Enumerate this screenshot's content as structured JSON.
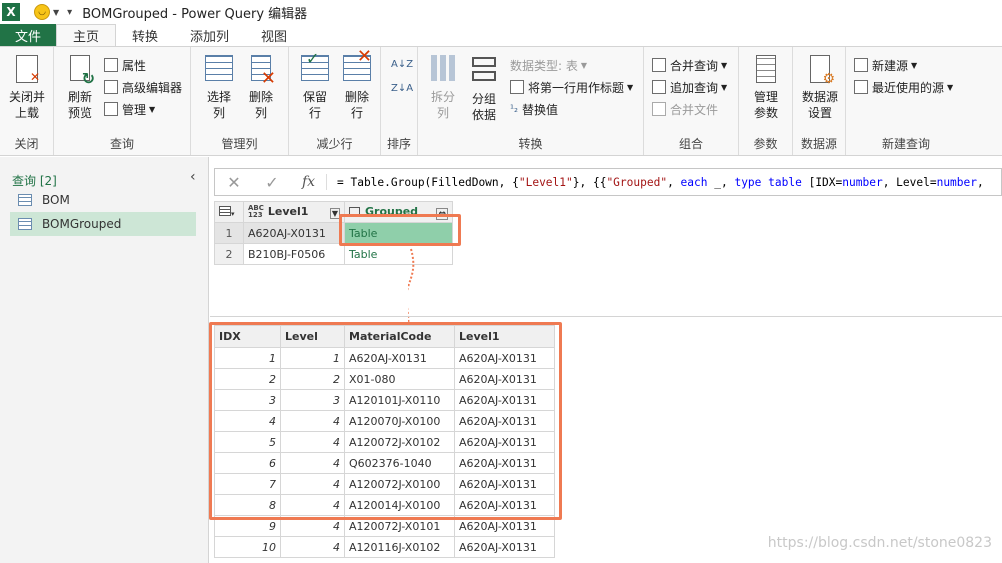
{
  "window": {
    "app_icon": "X",
    "title": "BOMGrouped - Power Query 编辑器"
  },
  "tabs": [
    "文件",
    "主页",
    "转换",
    "添加列",
    "视图"
  ],
  "ribbon": {
    "close": {
      "btn": "关闭并\n上载",
      "label": "关闭"
    },
    "query": {
      "refresh": "刷新\n预览",
      "properties": "属性",
      "advanced_editor": "高级编辑器",
      "manage": "管理",
      "label": "查询"
    },
    "manage_columns": {
      "choose": "选择\n列",
      "remove": "删除\n列",
      "label": "管理列"
    },
    "reduce_rows": {
      "keep": "保留\n行",
      "remove": "删除\n行",
      "label": "减少行"
    },
    "sort": {
      "label": "排序"
    },
    "transform": {
      "split": "拆分\n列",
      "group": "分组\n依据",
      "data_type": "数据类型: 表",
      "first_row_header": "将第一行用作标题",
      "replace": "替换值",
      "label": "转换"
    },
    "combine": {
      "merge": "合并查询",
      "append": "追加查询",
      "combine_files": "合并文件",
      "label": "组合"
    },
    "params": {
      "manage": "管理\n参数",
      "label": "参数"
    },
    "datasource": {
      "settings": "数据源\n设置",
      "label": "数据源"
    },
    "new_query": {
      "new_source": "新建源",
      "recent": "最近使用的源",
      "label": "新建查询"
    }
  },
  "queries_panel": {
    "header": "查询 [2]",
    "items": [
      "BOM",
      "BOMGrouped"
    ]
  },
  "formula": {
    "cancel": "✕",
    "confirm": "✓",
    "fx": "fx",
    "text_parts": [
      "= Table.Group(FilledDown, {",
      "\"Level1\"",
      "}, {{",
      "\"Grouped\"",
      ", ",
      "each",
      " _, ",
      "type",
      " ",
      "table",
      " [IDX=",
      "number",
      ", Level=",
      "number",
      ","
    ]
  },
  "grouped_grid": {
    "col1_type": "ABC\n123",
    "col1": "Level1",
    "col2": "Grouped",
    "rows": [
      {
        "n": "1",
        "level1": "A620AJ-X0131",
        "grouped": "Table"
      },
      {
        "n": "2",
        "level1": "B210BJ-F0506",
        "grouped": "Table"
      }
    ]
  },
  "detail_table": {
    "headers": [
      "IDX",
      "Level",
      "MaterialCode",
      "Level1"
    ],
    "rows": [
      [
        "1",
        "1",
        "A620AJ-X0131",
        "A620AJ-X0131"
      ],
      [
        "2",
        "2",
        "X01-080",
        "A620AJ-X0131"
      ],
      [
        "3",
        "3",
        "A120101J-X0110",
        "A620AJ-X0131"
      ],
      [
        "4",
        "4",
        "A120070J-X0100",
        "A620AJ-X0131"
      ],
      [
        "5",
        "4",
        "A120072J-X0102",
        "A620AJ-X0131"
      ],
      [
        "6",
        "4",
        "Q602376-1040",
        "A620AJ-X0131"
      ],
      [
        "7",
        "4",
        "A120072J-X0100",
        "A620AJ-X0131"
      ],
      [
        "8",
        "4",
        "A120014J-X0100",
        "A620AJ-X0131"
      ],
      [
        "9",
        "4",
        "A120072J-X0101",
        "A620AJ-X0131"
      ],
      [
        "10",
        "4",
        "A120116J-X0102",
        "A620AJ-X0131"
      ]
    ]
  },
  "watermark": "https://blog.csdn.net/stone0823",
  "colors": {
    "accent": "#217346",
    "highlight": "#ef7a52"
  }
}
